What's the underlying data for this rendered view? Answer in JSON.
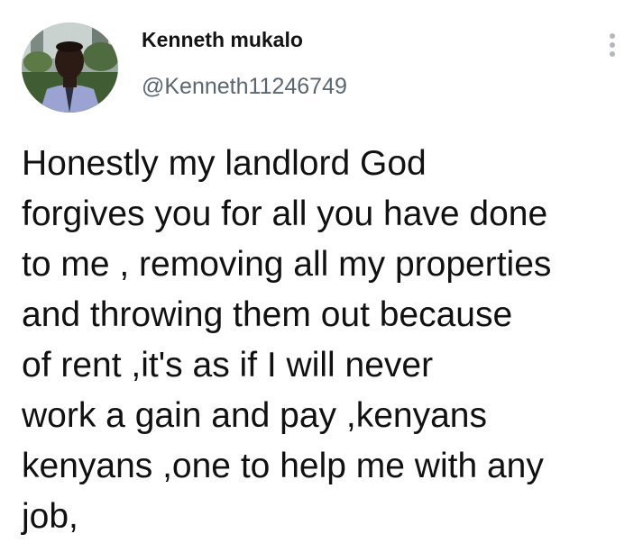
{
  "author": {
    "display_name": "Kenneth mukalo",
    "handle": "@Kenneth11246749",
    "avatar_icon": "profile-photo"
  },
  "menu": {
    "icon": "more-vertical-icon"
  },
  "tweet": {
    "lines": [
      "Honestly my landlord God",
      "forgives you for all you have done",
      "to me , removing all my properties",
      "and throwing them out because",
      "of rent ,it's as if I will never",
      "work a gain and pay ,kenyans",
      "kenyans ,one to help me with any",
      "job,"
    ]
  },
  "colors": {
    "text": "#111111",
    "handle": "#5b6770",
    "menu_dots": "#b3b8bd"
  }
}
